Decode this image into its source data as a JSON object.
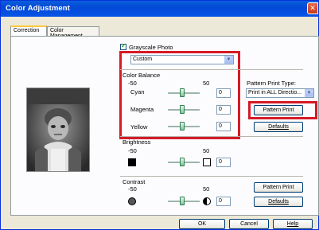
{
  "window": {
    "title": "Color Adjustment",
    "close_glyph": "✕"
  },
  "tabs": [
    {
      "label": "Correction"
    },
    {
      "label": "Color Management"
    }
  ],
  "grayscale": {
    "label": "Grayscale Photo",
    "checked": true
  },
  "preset": {
    "value": "Custom"
  },
  "color_balance": {
    "title": "Color Balance",
    "min_label": "-50",
    "max_label": "50",
    "rows": [
      {
        "label": "Cyan",
        "value": "0"
      },
      {
        "label": "Magenta",
        "value": "0"
      },
      {
        "label": "Yellow",
        "value": "0"
      }
    ]
  },
  "pattern": {
    "type_label": "Pattern Print Type:",
    "type_value": "Print in ALL Directio...",
    "print_button": "Pattern Print",
    "defaults_button": "Defaults"
  },
  "brightness": {
    "title": "Brightness",
    "min_label": "-50",
    "max_label": "50",
    "value": "0"
  },
  "contrast": {
    "title": "Contrast",
    "min_label": "-50",
    "max_label": "50",
    "value": "0",
    "print_button": "Pattern Print",
    "defaults_button": "Defaults"
  },
  "footer": {
    "ok": "OK",
    "cancel": "Cancel",
    "help": "Help"
  },
  "colors": {
    "highlight": "#d61a26",
    "titlebar": "#0349d6"
  }
}
